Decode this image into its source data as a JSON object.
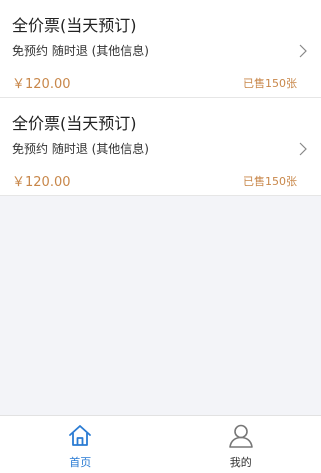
{
  "tickets": [
    {
      "title": "全价票(当天预订)",
      "description": "免预约 随时退 (其他信息)",
      "price": "￥120.00",
      "sold": "已售150张"
    },
    {
      "title": "全价票(当天预订)",
      "description": "免预约 随时退 (其他信息)",
      "price": "￥120.00",
      "sold": "已售150张"
    }
  ],
  "tabbar": {
    "home_label": "首页",
    "mine_label": "我的",
    "home_icon": "home-icon",
    "mine_icon": "user-icon",
    "active_color": "#2a7bd3",
    "inactive_color": "#777777"
  },
  "colors": {
    "price": "#c8874a",
    "background": "#f3f4f8"
  }
}
